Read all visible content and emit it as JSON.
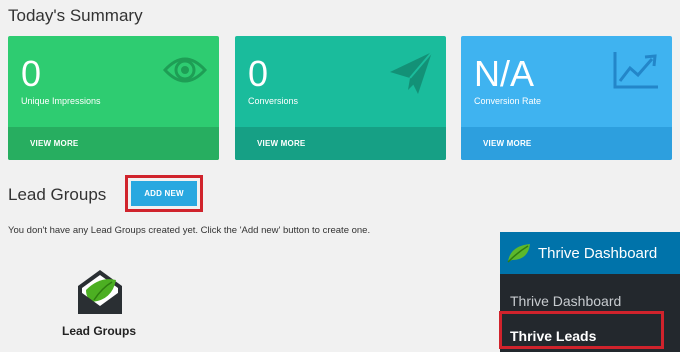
{
  "summary": {
    "title": "Today's Summary",
    "cards": [
      {
        "value": "0",
        "label": "Unique Impressions",
        "footer": "VIEW MORE",
        "icon": "eye-icon"
      },
      {
        "value": "0",
        "label": "Conversions",
        "footer": "VIEW MORE",
        "icon": "paper-plane-icon"
      },
      {
        "value": "N/A",
        "label": "Conversion Rate",
        "footer": "VIEW MORE",
        "icon": "trending-chart-icon"
      }
    ]
  },
  "lead_groups": {
    "title": "Lead Groups",
    "add_button": "ADD NEW",
    "empty_message": "You don't have any Lead Groups created yet. Click the 'Add new' button to create one.",
    "logo_label": "Lead Groups"
  },
  "admin_menu": {
    "header": "Thrive Dashboard",
    "items": [
      "Thrive Dashboard",
      "Thrive Leads"
    ]
  },
  "colors": {
    "card_green": "#2ecc71",
    "card_teal": "#1abc9c",
    "card_blue": "#3fb3f0",
    "button_blue": "#29a8e0",
    "highlight_red": "#d0232c",
    "menu_header": "#0073aa",
    "menu_bg": "#23282d"
  }
}
